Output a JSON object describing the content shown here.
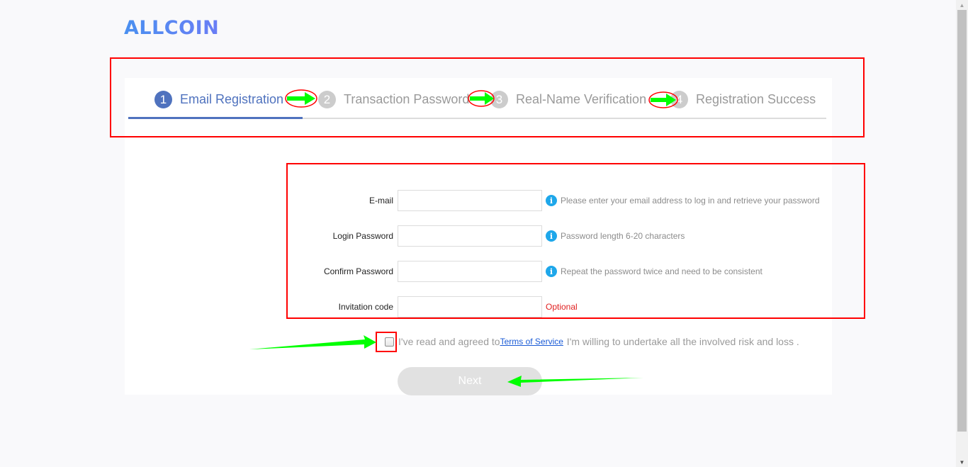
{
  "brand": {
    "logo_text": "ALLCOIN",
    "color": "#4d8cf5"
  },
  "steps": [
    {
      "number": "1",
      "label": "Email Registration",
      "state": "active"
    },
    {
      "number": "2",
      "label": "Transaction Password",
      "state": "pending"
    },
    {
      "number": "3",
      "label": "Real-Name Verification",
      "state": "pending"
    },
    {
      "number": "4",
      "label": "Registration Success",
      "state": "pending"
    }
  ],
  "form": {
    "fields": [
      {
        "label": "E-mail",
        "value": "",
        "placeholder": "",
        "hint": "Please enter your email address to log in and retrieve your password",
        "hint_icon": "info-icon"
      },
      {
        "label": "Login Password",
        "value": "",
        "placeholder": "",
        "hint": "Password length 6-20 characters",
        "hint_icon": "info-icon"
      },
      {
        "label": "Confirm Password",
        "value": "",
        "placeholder": "",
        "hint": "Repeat the password twice and need to be consistent",
        "hint_icon": "info-icon"
      },
      {
        "label": "Invitation code",
        "value": "",
        "placeholder": "",
        "note": "Optional"
      }
    ]
  },
  "agreement": {
    "checked": false,
    "prefix": "I've read and agreed to",
    "link_text": "Terms of Service",
    "suffix": " I'm willing to undertake all the involved risk and loss ."
  },
  "next_button": {
    "label": "Next",
    "enabled": false
  },
  "colors": {
    "active_step": "#4f72be",
    "inactive_step": "#cccccc",
    "info": "#1ea7ea",
    "optional": "#e02020",
    "annotation_box": "#ff0000",
    "annotation_arrow": "#00ff00"
  },
  "icons": {
    "info": "i",
    "scroll_up": "▲",
    "scroll_down": "▼"
  }
}
